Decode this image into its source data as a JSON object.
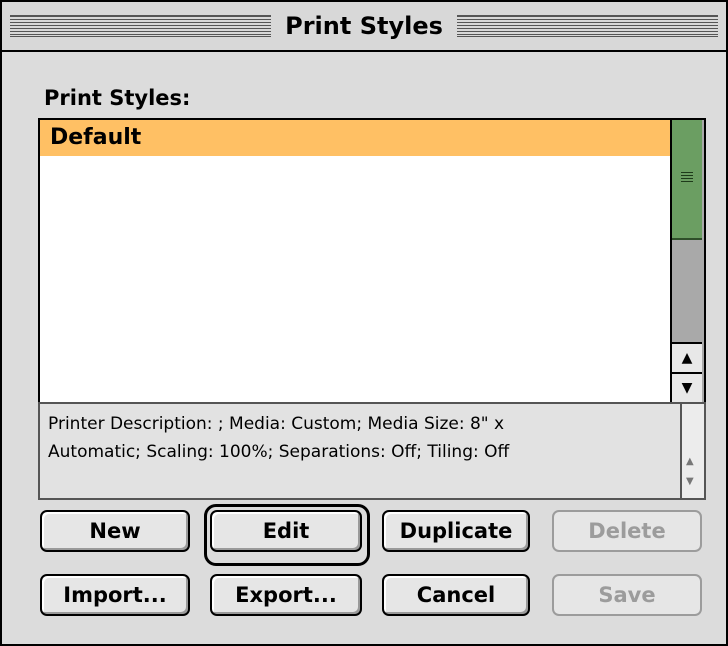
{
  "window": {
    "title": "Print Styles"
  },
  "list": {
    "label": "Print Styles:",
    "items": [
      "Default"
    ],
    "selected_index": 0
  },
  "description": {
    "line1": "Printer Description: ;  Media: Custom;  Media Size: 8\" x",
    "line2": "Automatic;  Scaling: 100%;  Separations: Off;  Tiling: Off"
  },
  "buttons": {
    "new": "New",
    "edit": "Edit",
    "duplicate": "Duplicate",
    "delete": "Delete",
    "import": "Import...",
    "export": "Export...",
    "cancel": "Cancel",
    "save": "Save"
  },
  "colors": {
    "selection": "#ffc064",
    "scroll_thumb": "#6b9e62"
  },
  "icons": {
    "up_arrow": "up-arrow-icon",
    "down_arrow": "down-arrow-icon",
    "grip": "scroll-grip-icon"
  }
}
